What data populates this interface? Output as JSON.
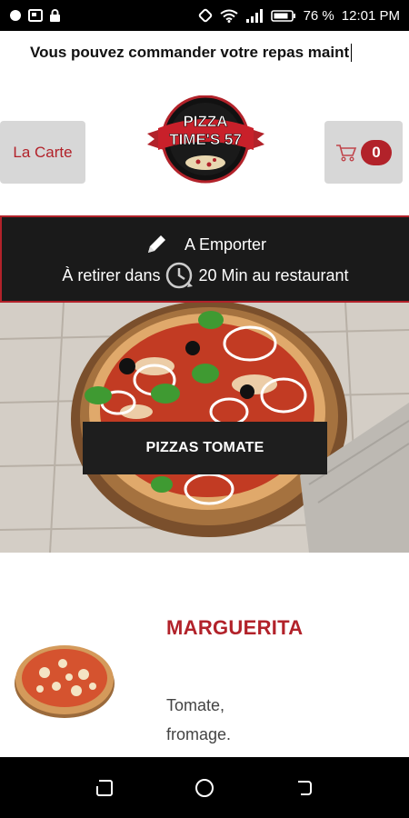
{
  "status_bar": {
    "battery": "76 %",
    "time": "12:01 PM"
  },
  "marquee": {
    "text": "Vous pouvez commander votre repas maint"
  },
  "header": {
    "carte_label": "La Carte",
    "logo_line1": "PIZZA",
    "logo_line2": "TIME'S 57",
    "cart_count": "0"
  },
  "order_info": {
    "mode": "A Emporter",
    "pickup_prefix": "À retirer dans",
    "pickup_suffix": "20 Min au restaurant"
  },
  "category": {
    "label": "PIZZAS TOMATE"
  },
  "product": {
    "name": "MARGUERITA",
    "description": "Tomate, fromage."
  },
  "colors": {
    "accent": "#b2222a",
    "dark": "#1a1a1a"
  }
}
